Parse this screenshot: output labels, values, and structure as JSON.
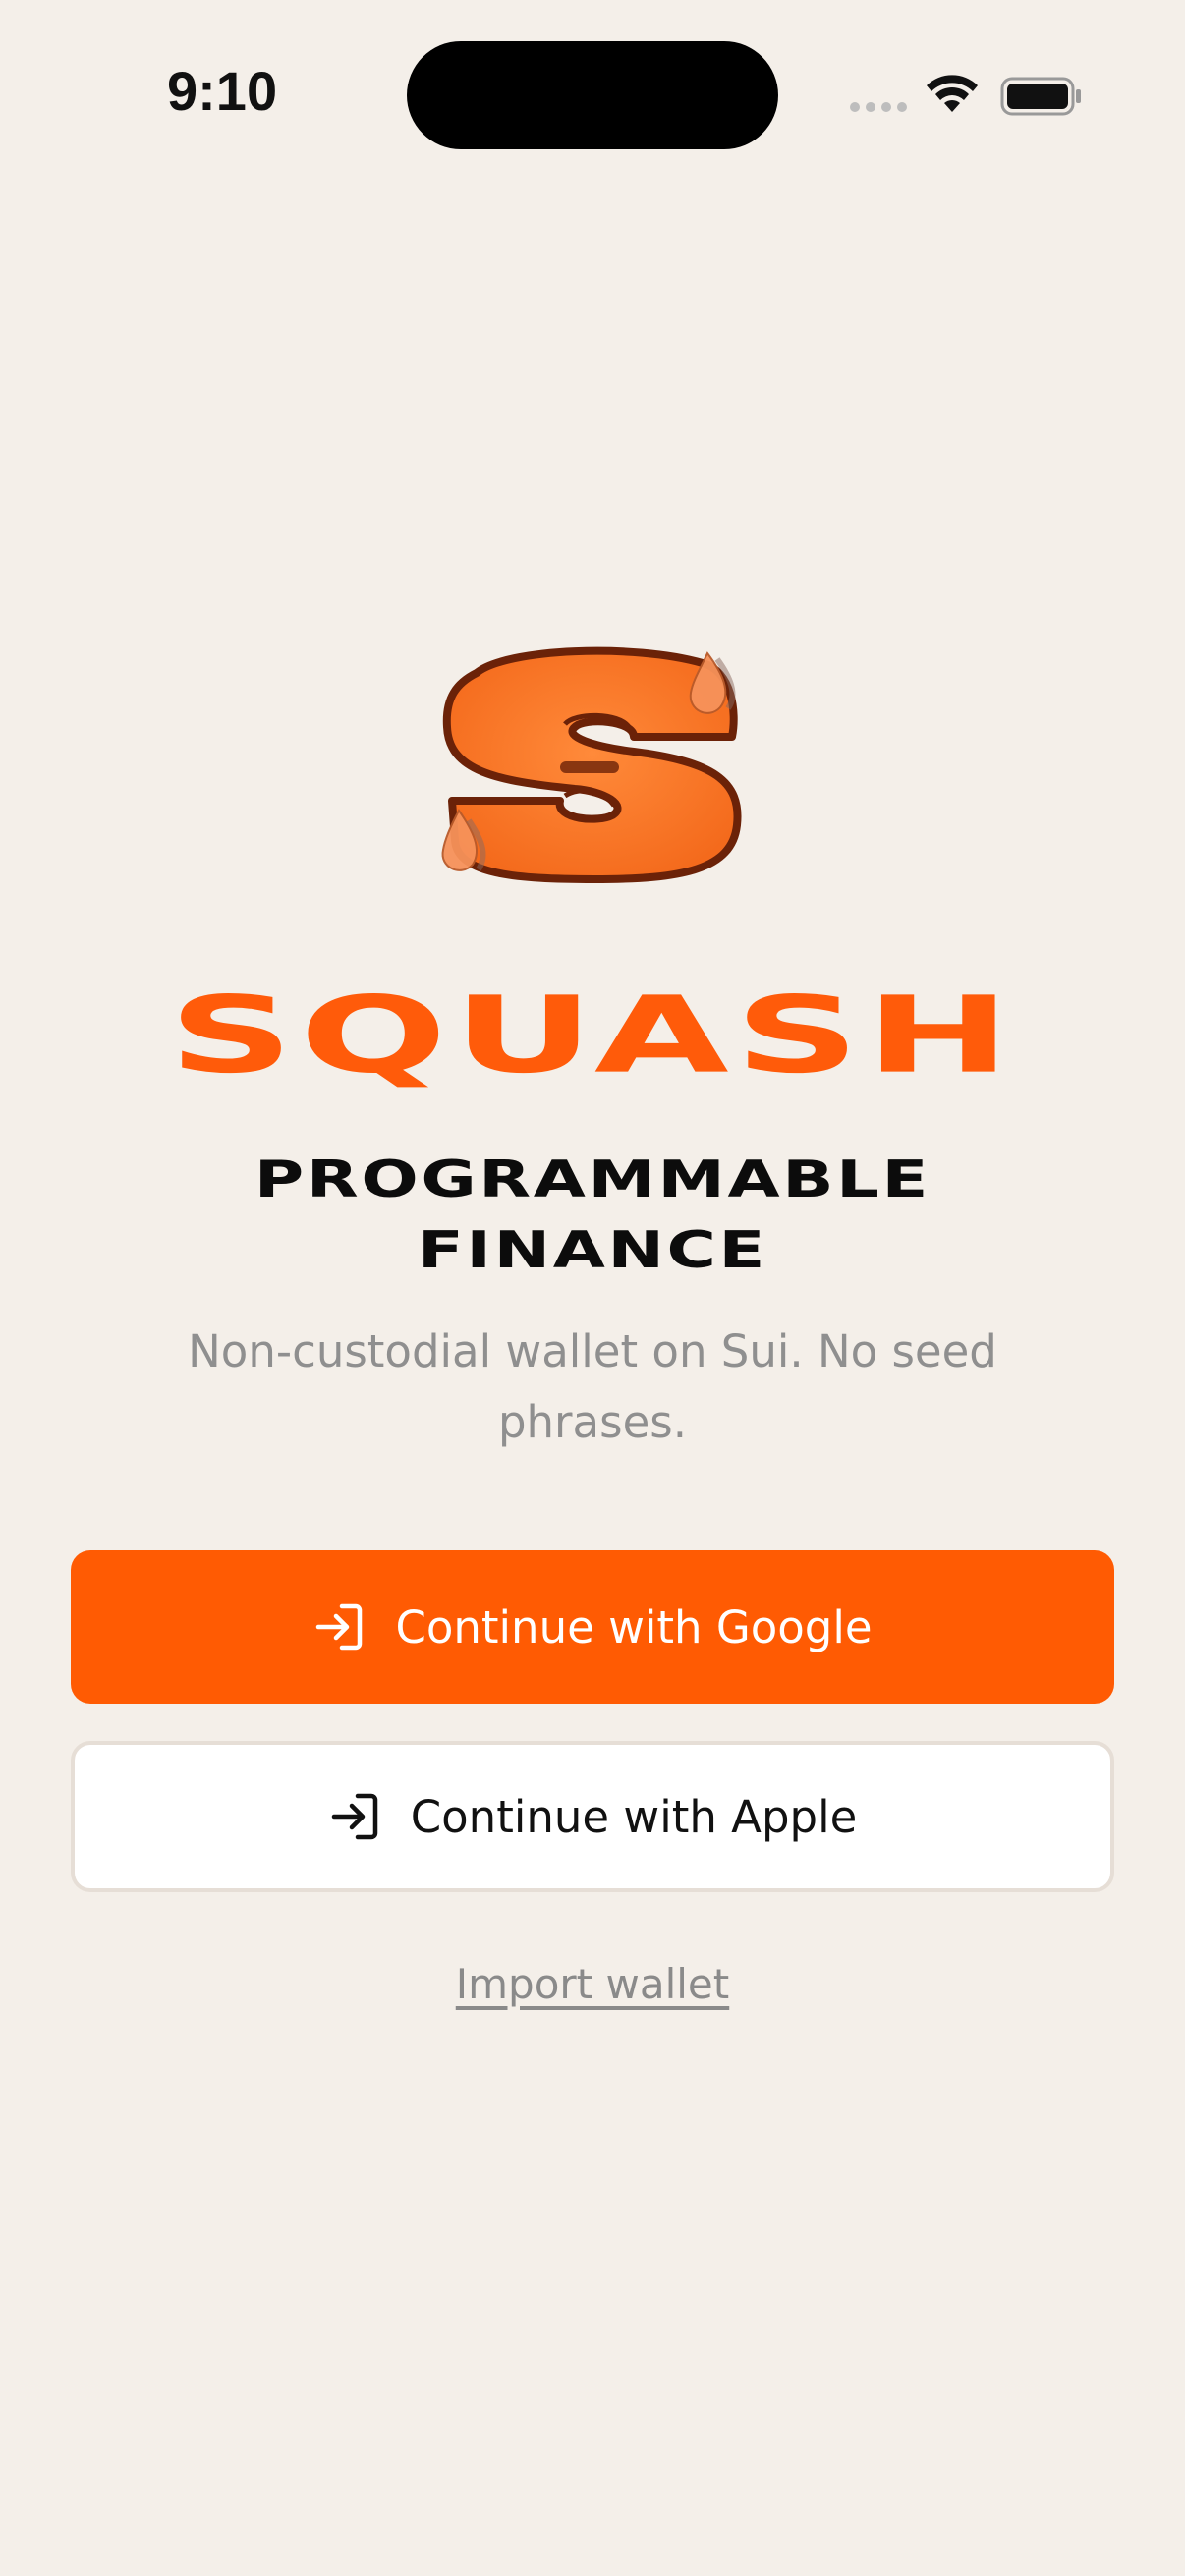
{
  "status_bar": {
    "time": "9:10"
  },
  "icons": {
    "wifi": "wifi-icon",
    "battery": "battery-icon",
    "login": "login-arrow-icon",
    "logo": "squash-s-logo"
  },
  "brand": {
    "title": "SQUASH",
    "tagline_line1": "PROGRAMMABLE",
    "tagline_line2": "FINANCE",
    "subtitle": "Non-custodial wallet on Sui. No seed phrases."
  },
  "actions": {
    "google_label": "Continue with Google",
    "apple_label": "Continue with Apple",
    "import_label": "Import wallet"
  },
  "colors": {
    "background": "#F4EFE9",
    "accent": "#FF5B03",
    "text_dark": "#111111",
    "text_muted": "#8F8F8F"
  }
}
